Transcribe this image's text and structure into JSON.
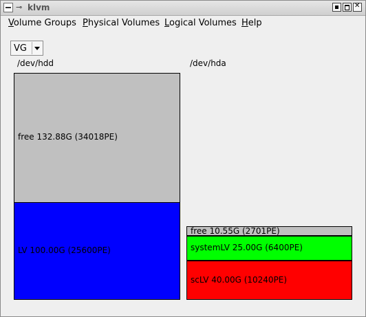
{
  "window": {
    "title": "klvm"
  },
  "menu": [
    {
      "first": "V",
      "rest": "olume Groups"
    },
    {
      "first": "P",
      "rest": "hysical Volumes"
    },
    {
      "first": "L",
      "rest": "ogical Volumes"
    },
    {
      "first": "H",
      "rest": "elp"
    }
  ],
  "vg_selector": {
    "value": "VG"
  },
  "physical_volumes": [
    {
      "name": "/dev/hdd",
      "segments": [
        {
          "label": "free 132.88G (34018PE)",
          "color": "#c0c0c0"
        },
        {
          "label": "LV 100.00G (25600PE)",
          "color": "#0000ff"
        }
      ]
    },
    {
      "name": "/dev/hda",
      "segments": [
        {
          "label": "free 10.55G (2701PE)",
          "color": "#c0c0c0"
        },
        {
          "label": "systemLV 25.00G (6400PE)",
          "color": "#00ff00"
        },
        {
          "label": "scLV 40.00G (10240PE)",
          "color": "#ff0000"
        }
      ]
    }
  ]
}
